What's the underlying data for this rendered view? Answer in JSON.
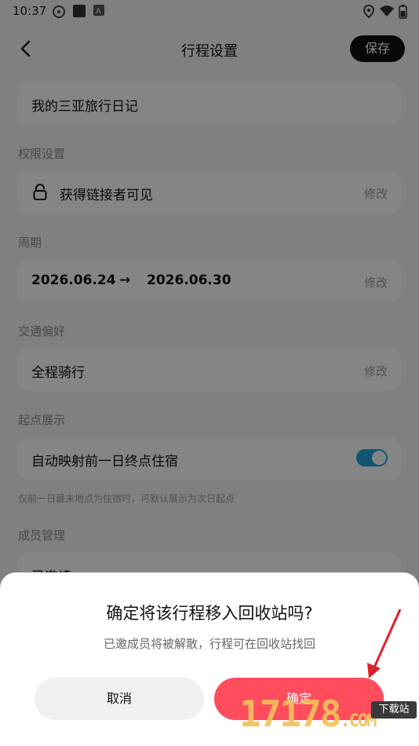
{
  "status_bar": {
    "time": "10:37"
  },
  "header": {
    "title": "行程设置",
    "save_label": "保存"
  },
  "trip_name": "我的三亚旅行日记",
  "permission": {
    "label": "权限设置",
    "value": "获得链接者可见",
    "edit": "修改"
  },
  "period": {
    "label": "周期",
    "start": "2026.06.24",
    "arrow": "→",
    "end": "2026.06.30",
    "edit": "修改"
  },
  "transport": {
    "label": "交通偏好",
    "value": "全程骑行",
    "edit": "修改"
  },
  "start_point": {
    "label": "起点展示",
    "value": "自动映射前一日终点住宿",
    "toggle_on": true,
    "hint": "仅前一日最末地点为住宿时，可默认展示为次日起点"
  },
  "members": {
    "label": "成员管理",
    "value": "已邀请"
  },
  "dialog": {
    "title": "确定将该行程移入回收站吗?",
    "subtitle": "已邀成员将被解散，行程可在回收站找回",
    "cancel_label": "取消",
    "confirm_label": "确定"
  },
  "watermark": {
    "text": "17178",
    "domain": ".COM",
    "tag": "下载站"
  },
  "colors": {
    "accent": "#ff4d5e",
    "toggle": "#1fa3d8",
    "annotation_arrow": "#e0202a"
  }
}
